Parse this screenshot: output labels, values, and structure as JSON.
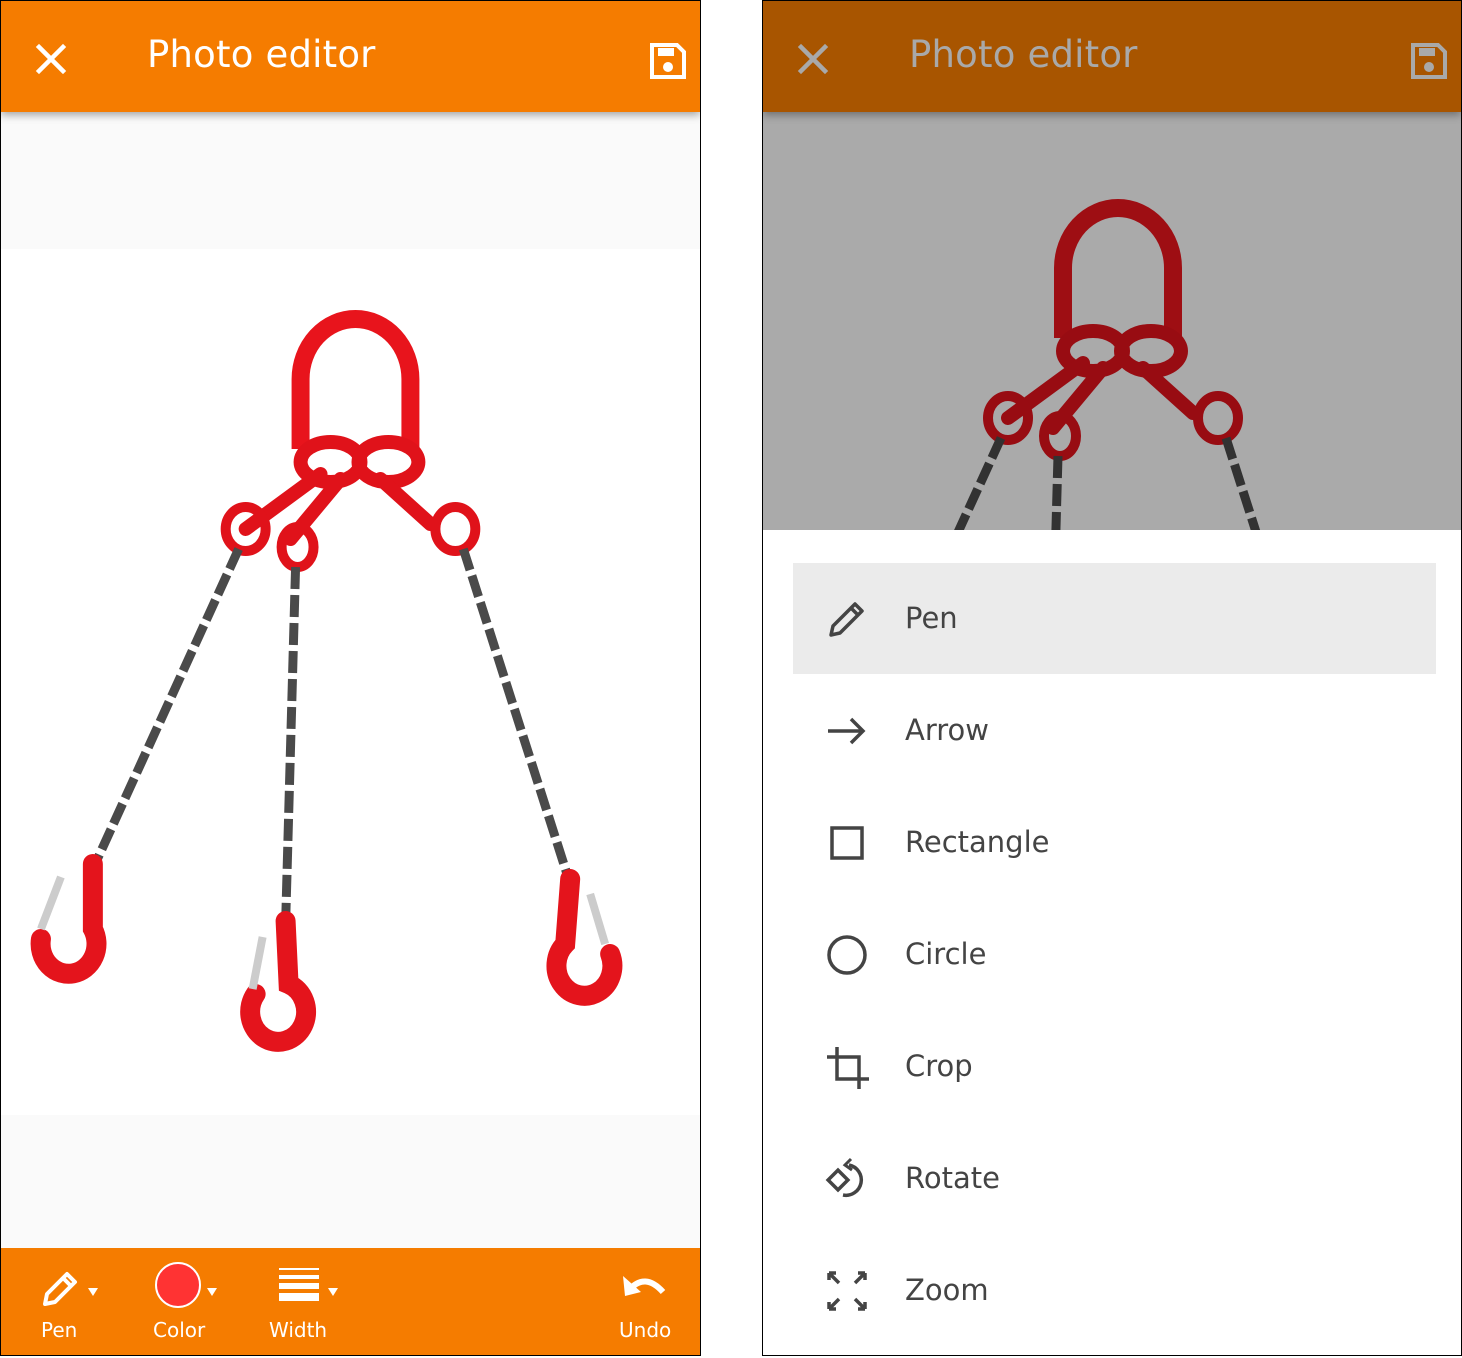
{
  "left_screen": {
    "appbar": {
      "title": "Photo editor",
      "close_icon": "close-icon",
      "save_icon": "save-icon",
      "background_color": "#f57c00"
    },
    "photo": {
      "description": "Red three-leg lifting chain sling with master link and grab hooks"
    },
    "toolbar": {
      "background_color": "#f57c00",
      "tools": [
        {
          "label": "Pen",
          "icon": "pencil-icon",
          "has_dropdown": true
        },
        {
          "label": "Color",
          "icon": "color-swatch",
          "has_dropdown": true,
          "value": "#ff3333"
        },
        {
          "label": "Width",
          "icon": "line-width-icon",
          "has_dropdown": true
        },
        {
          "label": "Undo",
          "icon": "undo-icon",
          "has_dropdown": false
        }
      ]
    }
  },
  "right_screen": {
    "appbar": {
      "title": "Photo editor",
      "close_icon": "close-icon",
      "save_icon": "save-icon",
      "background_color": "#a85500"
    },
    "tool_menu": {
      "selected": "Pen",
      "items": [
        {
          "label": "Pen",
          "icon": "pencil-icon"
        },
        {
          "label": "Arrow",
          "icon": "arrow-right-icon"
        },
        {
          "label": "Rectangle",
          "icon": "rectangle-icon"
        },
        {
          "label": "Circle",
          "icon": "circle-icon"
        },
        {
          "label": "Crop",
          "icon": "crop-icon"
        },
        {
          "label": "Rotate",
          "icon": "rotate-icon"
        },
        {
          "label": "Zoom",
          "icon": "zoom-fit-icon"
        }
      ]
    }
  }
}
